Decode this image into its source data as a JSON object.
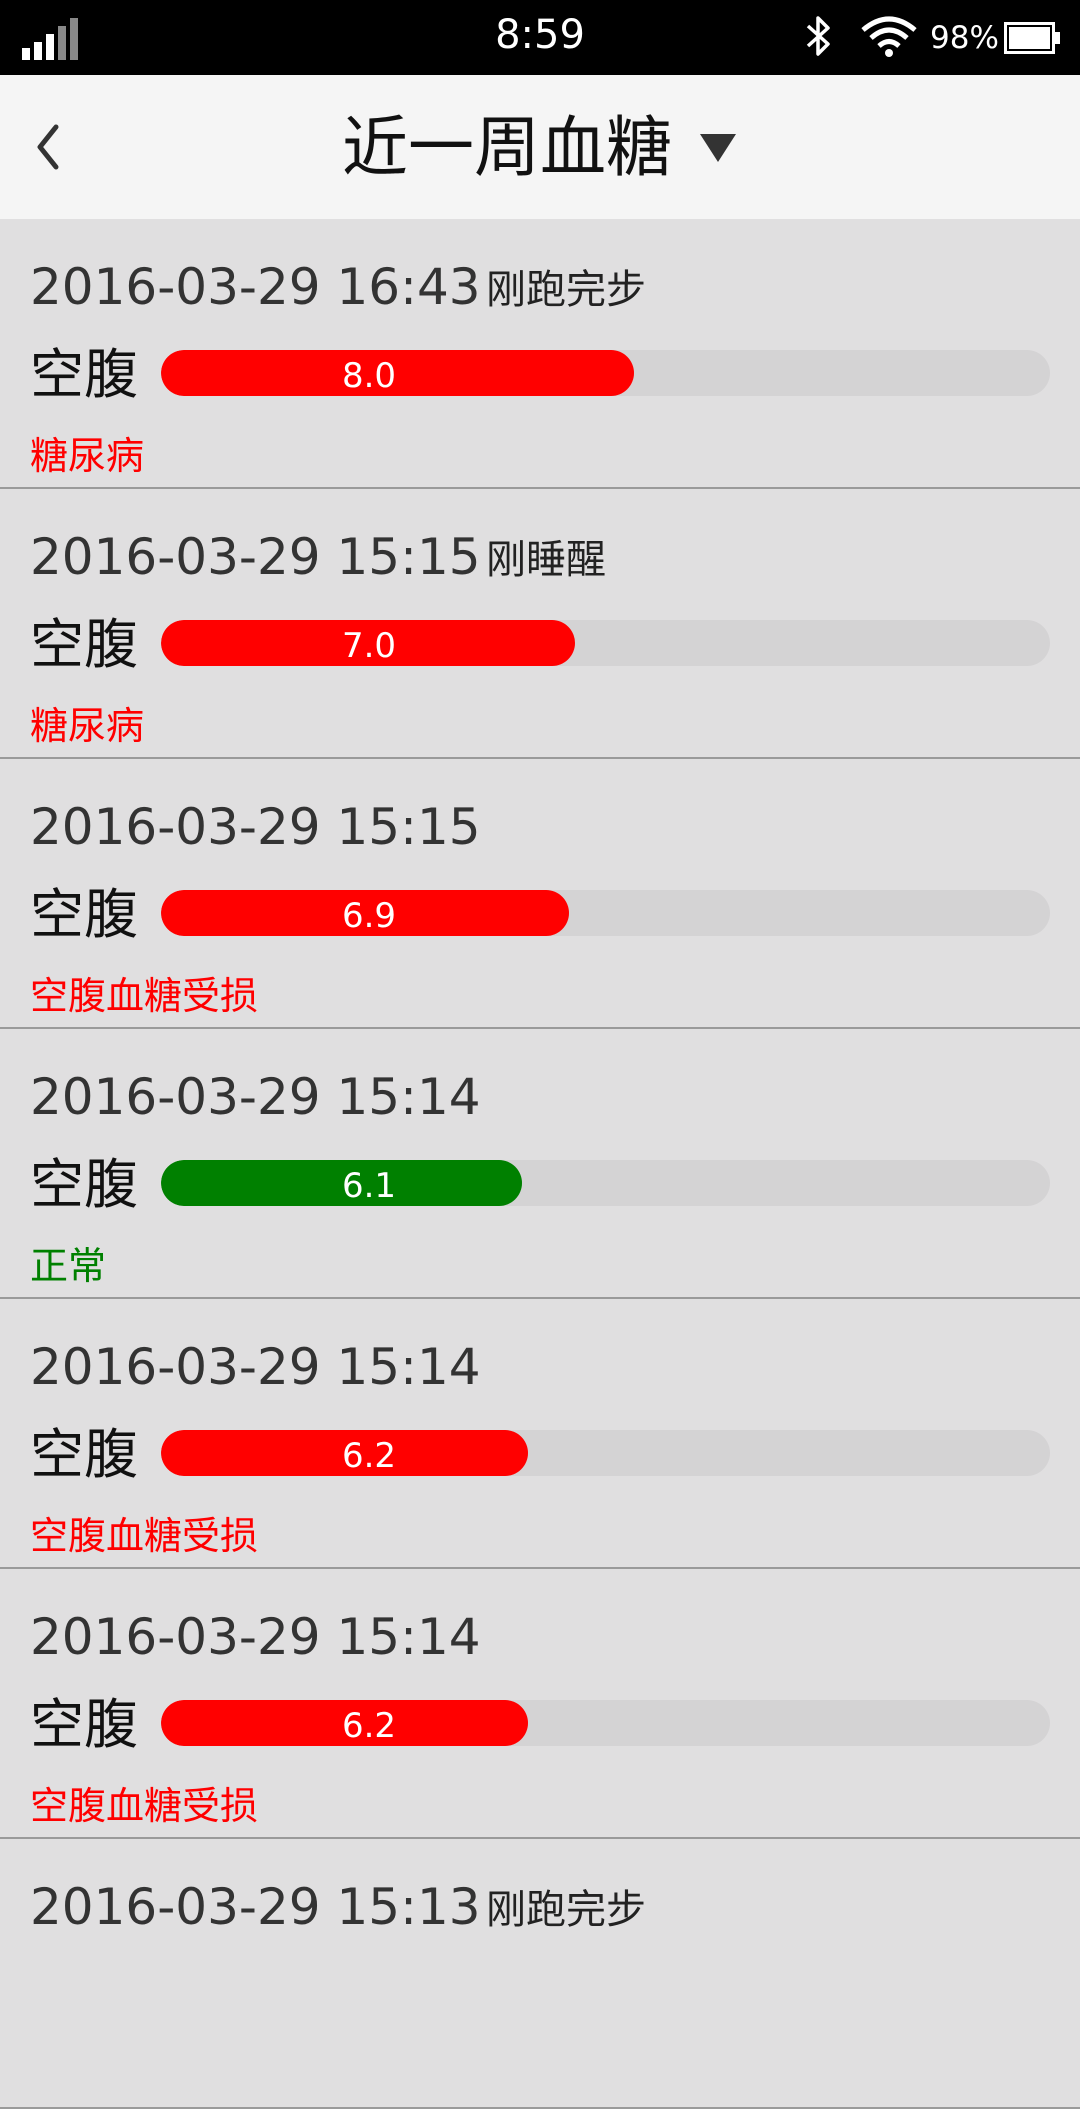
{
  "status_bar": {
    "time": "8:59",
    "battery": "98%"
  },
  "header": {
    "title": "近一周血糖"
  },
  "colors": {
    "high": "#ff0000",
    "normal": "#008000",
    "track": "#d4d3d4"
  },
  "records": [
    {
      "datetime": "2016-03-29 16:43",
      "note": "刚跑完步",
      "type": "空腹",
      "value": "8.0",
      "fill_fraction": 0.532,
      "status": "糖尿病",
      "level": "bad"
    },
    {
      "datetime": "2016-03-29 15:15",
      "note": "刚睡醒",
      "type": "空腹",
      "value": "7.0",
      "fill_fraction": 0.466,
      "status": "糖尿病",
      "level": "bad"
    },
    {
      "datetime": "2016-03-29 15:15",
      "note": "",
      "type": "空腹",
      "value": "6.9",
      "fill_fraction": 0.459,
      "status": "空腹血糖受损",
      "level": "bad"
    },
    {
      "datetime": "2016-03-29 15:14",
      "note": "",
      "type": "空腹",
      "value": "6.1",
      "fill_fraction": 0.406,
      "status": "正常",
      "level": "good"
    },
    {
      "datetime": "2016-03-29 15:14",
      "note": "",
      "type": "空腹",
      "value": "6.2",
      "fill_fraction": 0.413,
      "status": "空腹血糖受损",
      "level": "bad"
    },
    {
      "datetime": "2016-03-29 15:14",
      "note": "",
      "type": "空腹",
      "value": "6.2",
      "fill_fraction": 0.413,
      "status": "空腹血糖受损",
      "level": "bad"
    },
    {
      "datetime": "2016-03-29 15:13",
      "note": "刚跑完步",
      "type": "",
      "value": "",
      "fill_fraction": 0,
      "status": "",
      "level": "bad"
    }
  ]
}
